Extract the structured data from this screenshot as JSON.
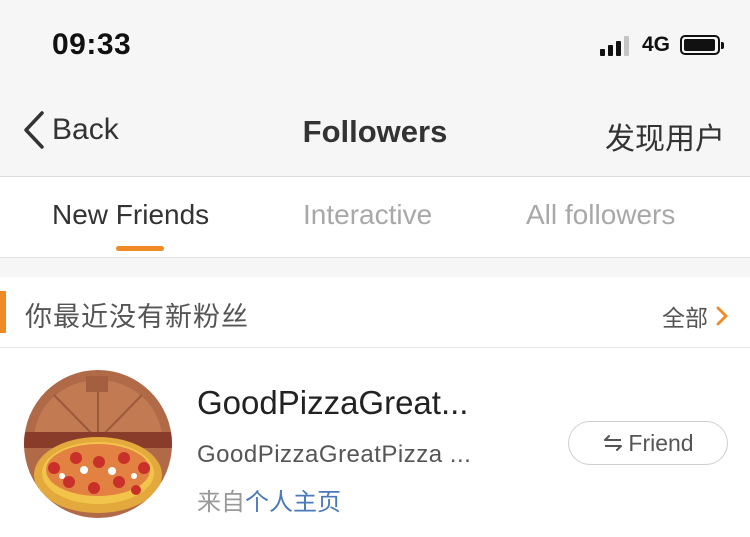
{
  "status_bar": {
    "time": "09:33",
    "network": "4G",
    "signal_icon": "cellular-signal-icon",
    "battery_icon": "battery-icon"
  },
  "nav": {
    "back_label": "Back",
    "back_icon": "chevron-left-icon",
    "title": "Followers",
    "discover_label": "发现用户"
  },
  "tabs": [
    {
      "label": "New Friends",
      "active": true
    },
    {
      "label": "Interactive",
      "active": false
    },
    {
      "label": "All followers",
      "active": false
    }
  ],
  "section": {
    "title": "你最近没有新粉丝",
    "see_all_label": "全部",
    "see_all_icon": "chevron-right-icon"
  },
  "user": {
    "name": "GoodPizzaGreat...",
    "description": "GoodPizzaGreatPizza ...",
    "source_prefix": "来自",
    "source_link": "个人主页",
    "avatar_icon": "pizza-avatar",
    "button_label": "Friend",
    "button_icon": "mutual-follow-icon"
  },
  "colors": {
    "accent": "#f08a24",
    "link": "#4a7ab8",
    "inactive_tab": "#a8a8a8",
    "background": "#f6f6f6"
  }
}
